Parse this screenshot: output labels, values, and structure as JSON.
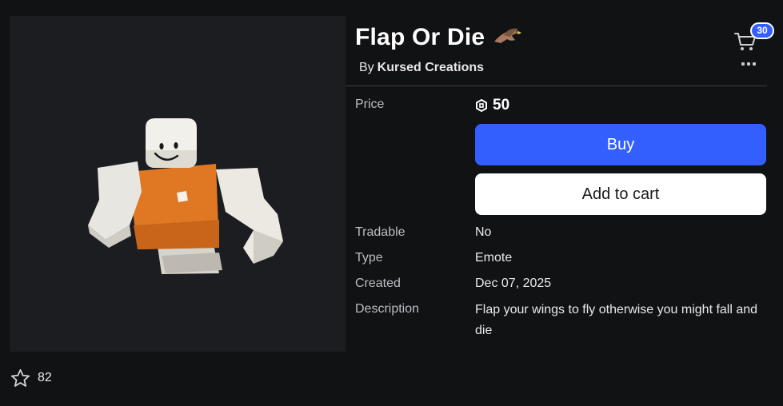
{
  "item": {
    "title": "Flap Or Die",
    "creator_prefix": "By",
    "creator_name": "Kursed Creations",
    "favorites": "82"
  },
  "header": {
    "cart_count": "30",
    "cart_icon": "cart-icon",
    "more_icon": "more-options-icon"
  },
  "details": {
    "price_label": "Price",
    "price_value": "50",
    "buy_label": "Buy",
    "add_to_cart_label": "Add to cart",
    "tradable_label": "Tradable",
    "tradable_value": "No",
    "type_label": "Type",
    "type_value": "Emote",
    "created_label": "Created",
    "created_value": "Dec 07, 2025",
    "description_label": "Description",
    "description_value": "Flap your wings to fly otherwise you might fall and die"
  },
  "colors": {
    "background": "#111214",
    "accent": "#335fff",
    "preview_bg": "#1c1d21"
  }
}
